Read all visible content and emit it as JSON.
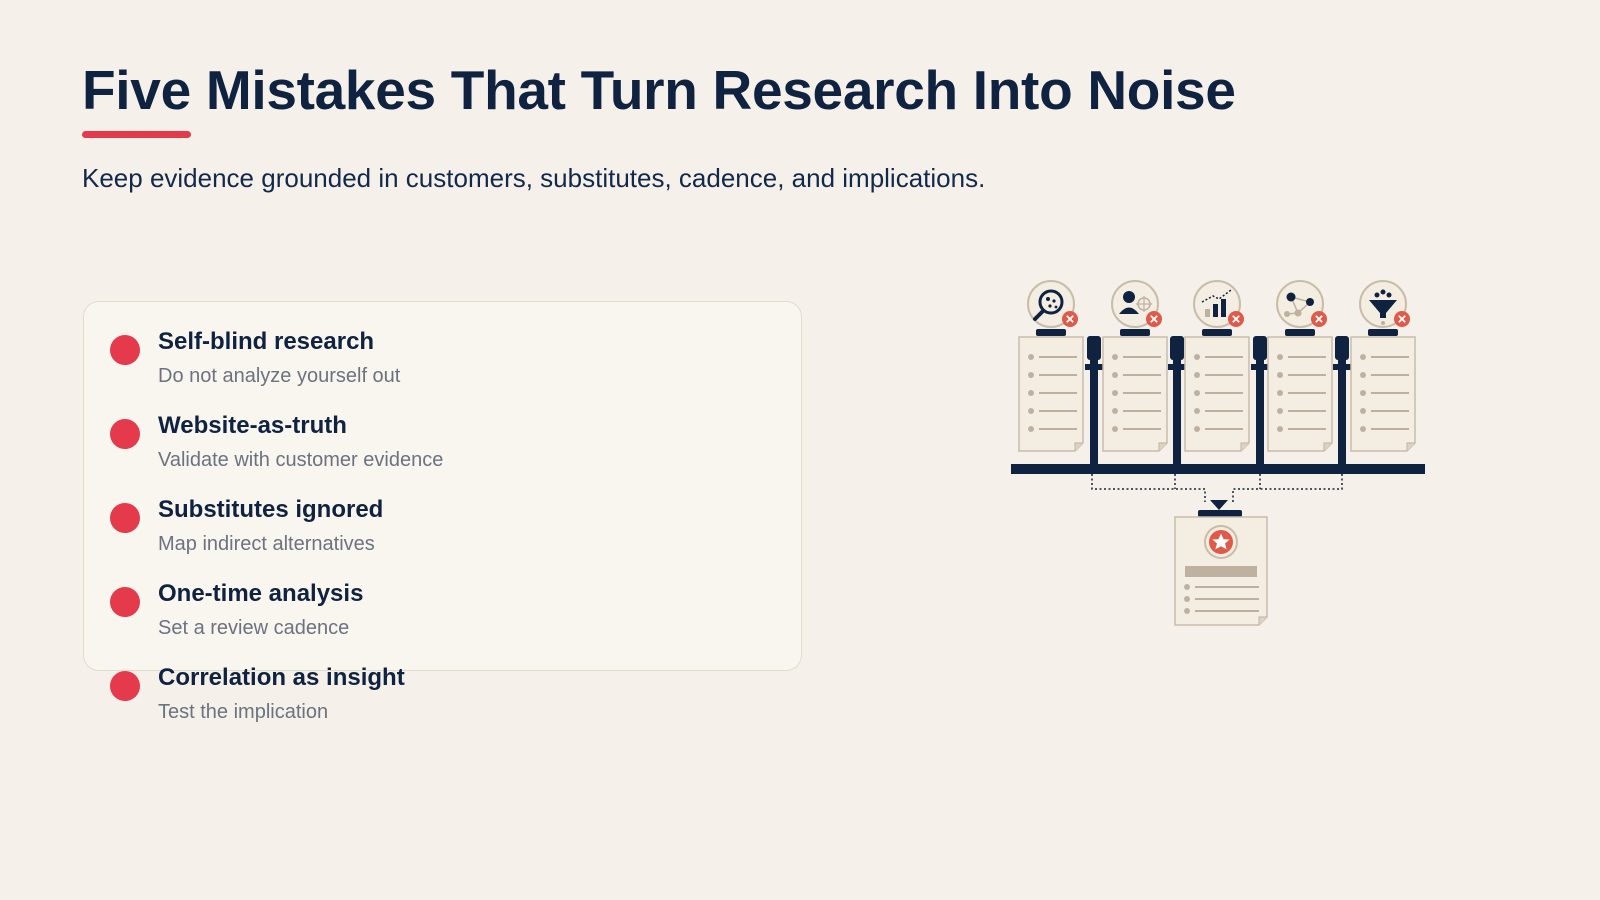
{
  "slide": {
    "title": "Five Mistakes That Turn Research Into Noise",
    "subtitle": "Keep evidence grounded in customers, substitutes, cadence, and implications."
  },
  "mistakes": [
    {
      "title": "Self-blind research",
      "description": "Do not analyze yourself out"
    },
    {
      "title": "Website-as-truth",
      "description": "Validate with customer evidence"
    },
    {
      "title": "Substitutes ignored",
      "description": "Map indirect alternatives"
    },
    {
      "title": "One-time analysis",
      "description": "Set a review cadence"
    },
    {
      "title": "Correlation as insight",
      "description": "Test the implication"
    }
  ],
  "illustration": {
    "icons": [
      "magnifier-dots-icon",
      "person-target-icon",
      "bar-chart-trend-icon",
      "network-nodes-icon",
      "funnel-icon"
    ],
    "colors": {
      "navy": "#0f2340",
      "red": "#e43a4b",
      "paper": "#f3ede2",
      "paper_border": "#c9bca9",
      "tan": "#bfb19f",
      "error": "#e05a4a"
    }
  }
}
